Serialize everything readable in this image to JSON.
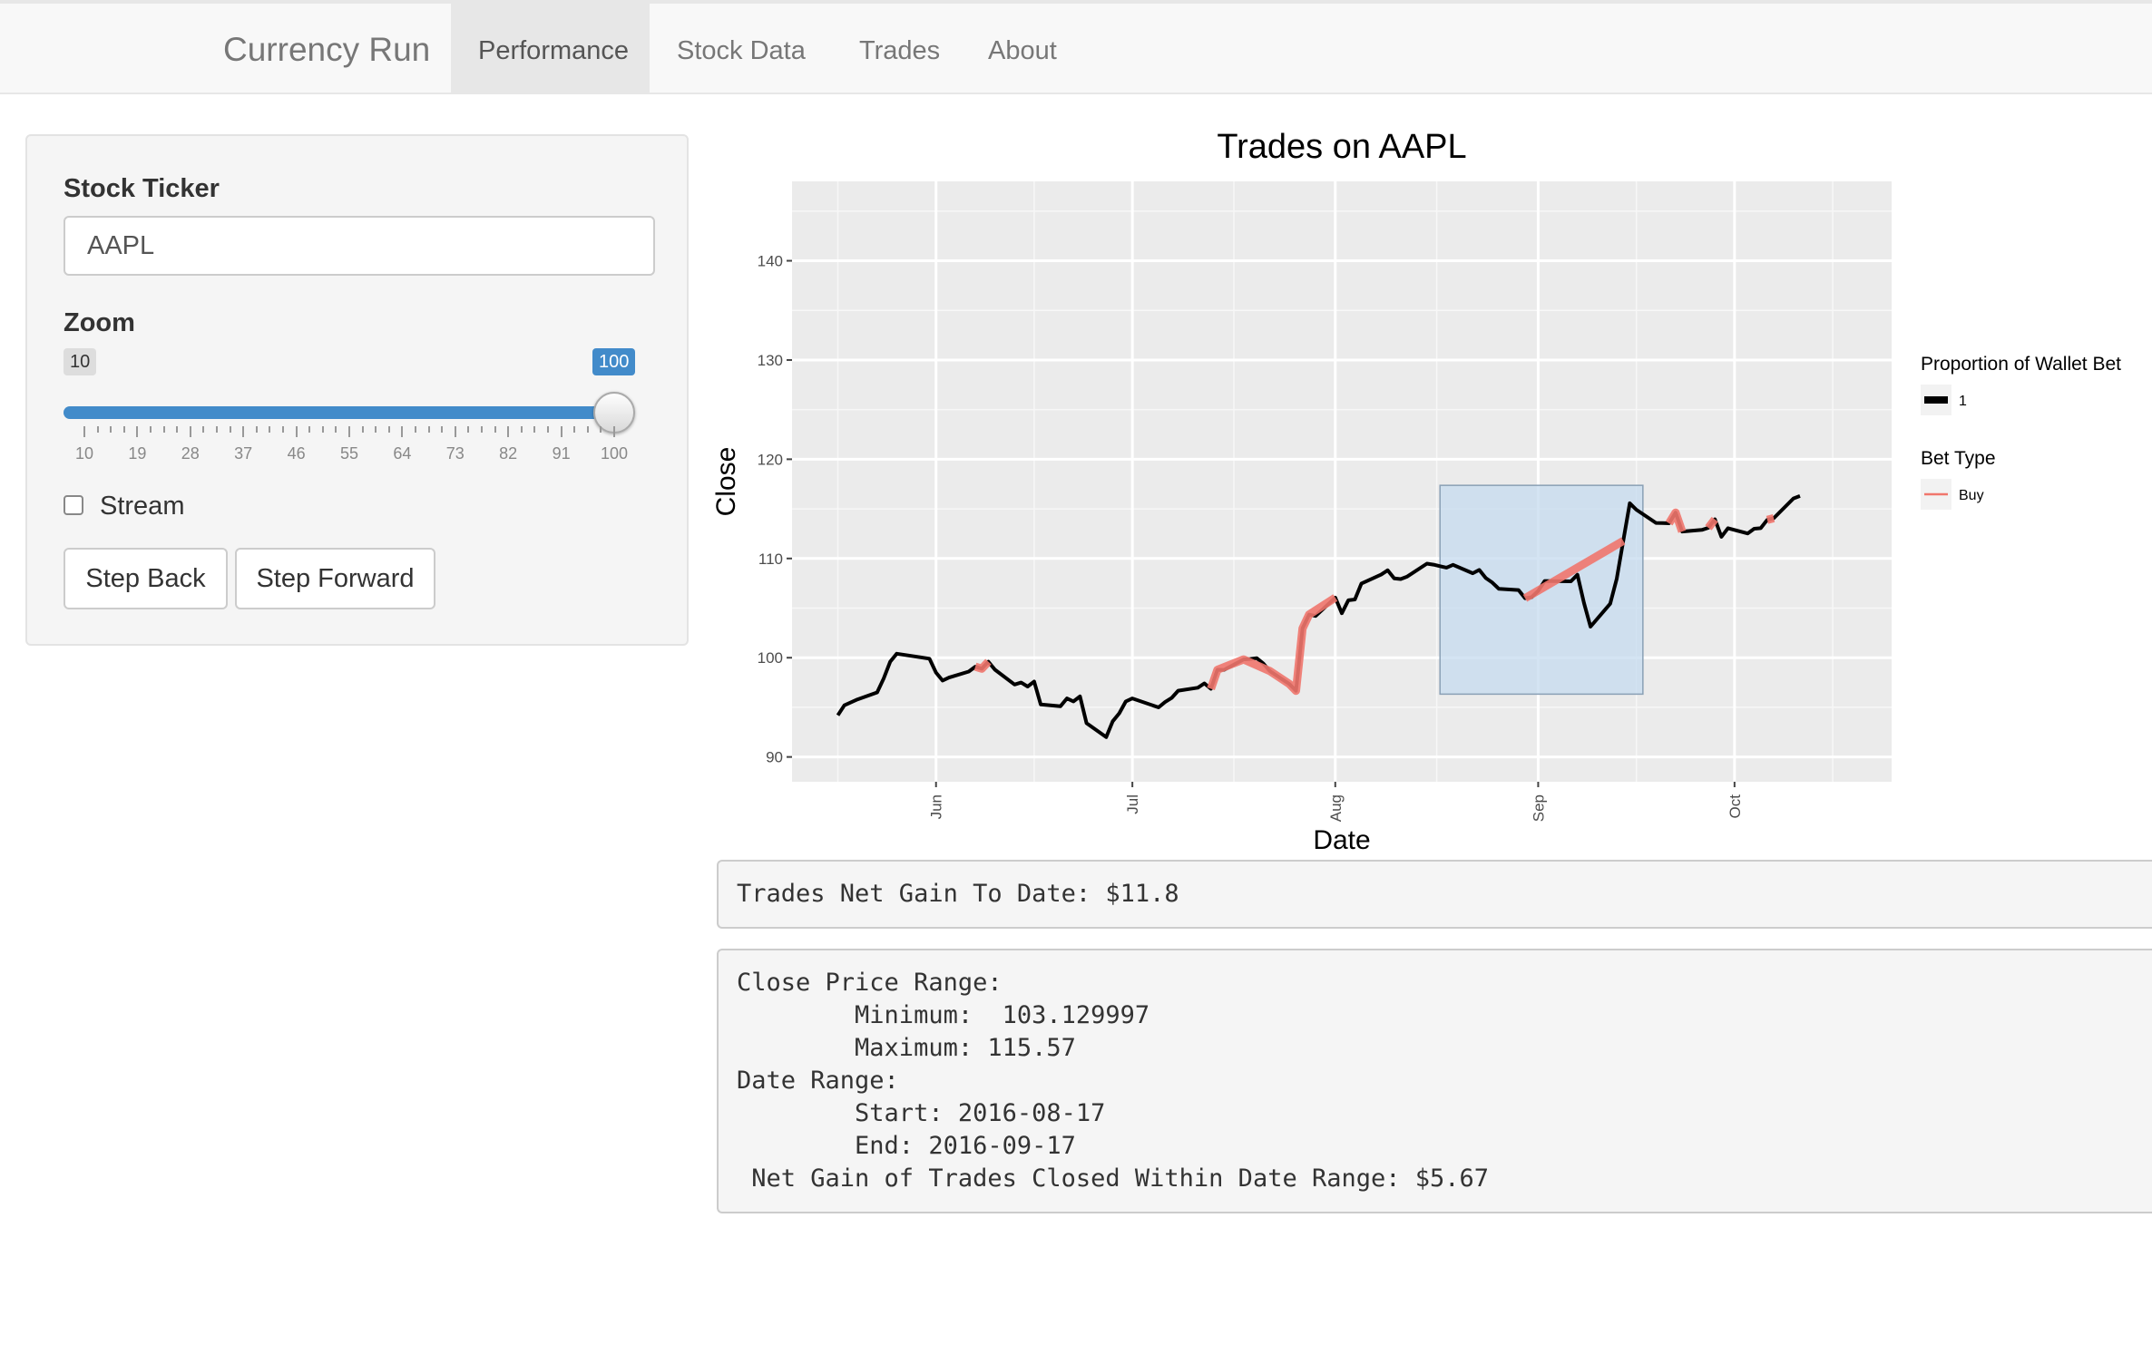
{
  "navbar": {
    "brand": "Currency Run",
    "tabs": [
      {
        "label": "Performance",
        "active": true
      },
      {
        "label": "Stock Data",
        "active": false
      },
      {
        "label": "Trades",
        "active": false
      },
      {
        "label": "About",
        "active": false
      }
    ]
  },
  "sidebar": {
    "ticker_label": "Stock Ticker",
    "ticker_value": "AAPL",
    "zoom_label": "Zoom",
    "zoom_min": "10",
    "zoom_max": "100",
    "zoom_value": "100",
    "zoom_ticks": [
      "10",
      "19",
      "28",
      "37",
      "46",
      "55",
      "64",
      "73",
      "82",
      "91",
      "100"
    ],
    "stream_label": "Stream",
    "stream_checked": false,
    "step_back_label": "Step Back",
    "step_forward_label": "Step Forward",
    "accent_color": "#428bca"
  },
  "chart_data": {
    "type": "line",
    "title": "Trades on AAPL",
    "xlabel": "Date",
    "ylabel": "Close",
    "x_ticks": [
      "Jun",
      "Jul",
      "Aug",
      "Sep",
      "Oct"
    ],
    "x_tick_dates": [
      "2016-06-01",
      "2016-07-01",
      "2016-08-01",
      "2016-09-01",
      "2016-10-01"
    ],
    "y_ticks": [
      90,
      100,
      110,
      120,
      130,
      140
    ],
    "xlim": [
      "2016-05-10",
      "2016-10-25"
    ],
    "ylim": [
      87.5,
      148
    ],
    "grid": true,
    "series": [
      {
        "color": "#000000",
        "points": [
          [
            "2016-05-17",
            94.2
          ],
          [
            "2016-05-18",
            95.2
          ],
          [
            "2016-05-20",
            95.8
          ],
          [
            "2016-05-23",
            96.5
          ],
          [
            "2016-05-24",
            97.9
          ],
          [
            "2016-05-25",
            99.6
          ],
          [
            "2016-05-26",
            100.4
          ],
          [
            "2016-05-31",
            99.9
          ],
          [
            "2016-06-01",
            98.5
          ],
          [
            "2016-06-02",
            97.7
          ],
          [
            "2016-06-03",
            98.0
          ],
          [
            "2016-06-06",
            98.6
          ],
          [
            "2016-06-07",
            99.1
          ],
          [
            "2016-06-08",
            98.9
          ],
          [
            "2016-06-09",
            99.6
          ],
          [
            "2016-06-10",
            98.8
          ],
          [
            "2016-06-13",
            97.3
          ],
          [
            "2016-06-14",
            97.5
          ],
          [
            "2016-06-15",
            97.1
          ],
          [
            "2016-06-16",
            97.6
          ],
          [
            "2016-06-17",
            95.3
          ],
          [
            "2016-06-20",
            95.1
          ],
          [
            "2016-06-21",
            95.9
          ],
          [
            "2016-06-22",
            95.6
          ],
          [
            "2016-06-23",
            96.1
          ],
          [
            "2016-06-24",
            93.4
          ],
          [
            "2016-06-27",
            92.0
          ],
          [
            "2016-06-28",
            93.6
          ],
          [
            "2016-06-29",
            94.4
          ],
          [
            "2016-06-30",
            95.6
          ],
          [
            "2016-07-01",
            95.9
          ],
          [
            "2016-07-05",
            94.99
          ],
          [
            "2016-07-06",
            95.53
          ],
          [
            "2016-07-07",
            95.94
          ],
          [
            "2016-07-08",
            96.68
          ],
          [
            "2016-07-11",
            96.98
          ],
          [
            "2016-07-12",
            97.42
          ],
          [
            "2016-07-13",
            96.87
          ],
          [
            "2016-07-14",
            98.79
          ],
          [
            "2016-07-15",
            98.78
          ],
          [
            "2016-07-18",
            99.83
          ],
          [
            "2016-07-19",
            99.87
          ],
          [
            "2016-07-20",
            99.96
          ],
          [
            "2016-07-21",
            99.43
          ],
          [
            "2016-07-22",
            98.66
          ],
          [
            "2016-07-25",
            97.34
          ],
          [
            "2016-07-26",
            96.67
          ],
          [
            "2016-07-27",
            102.95
          ],
          [
            "2016-07-28",
            104.34
          ],
          [
            "2016-07-29",
            104.21
          ],
          [
            "2016-08-01",
            106.05
          ],
          [
            "2016-08-02",
            104.48
          ],
          [
            "2016-08-03",
            105.79
          ],
          [
            "2016-08-04",
            105.87
          ],
          [
            "2016-08-05",
            107.48
          ],
          [
            "2016-08-08",
            108.37
          ],
          [
            "2016-08-09",
            108.81
          ],
          [
            "2016-08-10",
            108.0
          ],
          [
            "2016-08-11",
            107.93
          ],
          [
            "2016-08-12",
            108.18
          ],
          [
            "2016-08-15",
            109.48
          ],
          [
            "2016-08-16",
            109.38
          ],
          [
            "2016-08-17",
            109.22
          ],
          [
            "2016-08-18",
            109.08
          ],
          [
            "2016-08-19",
            109.36
          ],
          [
            "2016-08-22",
            108.51
          ],
          [
            "2016-08-23",
            108.85
          ],
          [
            "2016-08-24",
            108.03
          ],
          [
            "2016-08-25",
            107.57
          ],
          [
            "2016-08-26",
            106.94
          ],
          [
            "2016-08-29",
            106.82
          ],
          [
            "2016-08-30",
            106.0
          ],
          [
            "2016-08-31",
            106.1
          ],
          [
            "2016-09-01",
            106.73
          ],
          [
            "2016-09-02",
            107.73
          ],
          [
            "2016-09-06",
            107.7
          ],
          [
            "2016-09-07",
            108.36
          ],
          [
            "2016-09-08",
            105.52
          ],
          [
            "2016-09-09",
            103.13
          ],
          [
            "2016-09-12",
            105.44
          ],
          [
            "2016-09-13",
            107.95
          ],
          [
            "2016-09-14",
            111.77
          ],
          [
            "2016-09-15",
            115.57
          ],
          [
            "2016-09-16",
            114.92
          ],
          [
            "2016-09-19",
            113.58
          ],
          [
            "2016-09-20",
            113.57
          ],
          [
            "2016-09-21",
            113.55
          ],
          [
            "2016-09-22",
            114.62
          ],
          [
            "2016-09-23",
            112.71
          ],
          [
            "2016-09-26",
            112.88
          ],
          [
            "2016-09-27",
            113.09
          ],
          [
            "2016-09-28",
            113.95
          ],
          [
            "2016-09-29",
            112.18
          ],
          [
            "2016-09-30",
            113.05
          ],
          [
            "2016-10-03",
            112.52
          ],
          [
            "2016-10-04",
            113.0
          ],
          [
            "2016-10-05",
            113.05
          ],
          [
            "2016-10-06",
            113.89
          ],
          [
            "2016-10-07",
            114.06
          ],
          [
            "2016-10-10",
            116.05
          ],
          [
            "2016-10-11",
            116.3
          ]
        ]
      }
    ],
    "trades": [
      {
        "type": "Buy",
        "color": "#f0766d",
        "points": [
          [
            "2016-06-07",
            99.1
          ],
          [
            "2016-06-08",
            98.9
          ],
          [
            "2016-06-09",
            99.6
          ]
        ]
      },
      {
        "type": "Buy",
        "color": "#f0766d",
        "points": [
          [
            "2016-07-13",
            96.87
          ],
          [
            "2016-07-14",
            98.79
          ],
          [
            "2016-07-18",
            99.83
          ],
          [
            "2016-07-22",
            98.66
          ],
          [
            "2016-07-25",
            97.34
          ],
          [
            "2016-07-26",
            96.67
          ],
          [
            "2016-07-27",
            102.95
          ],
          [
            "2016-07-28",
            104.34
          ],
          [
            "2016-08-01",
            106.05
          ]
        ]
      },
      {
        "type": "Buy",
        "color": "#f0766d",
        "points": [
          [
            "2016-08-30",
            106.0
          ],
          [
            "2016-09-14",
            111.77
          ]
        ]
      },
      {
        "type": "Buy",
        "color": "#f0766d",
        "points": [
          [
            "2016-09-21",
            113.55
          ],
          [
            "2016-09-22",
            114.62
          ],
          [
            "2016-09-23",
            112.71
          ]
        ]
      },
      {
        "type": "Buy",
        "color": "#f0766d",
        "points": [
          [
            "2016-09-27",
            113.09
          ],
          [
            "2016-09-28",
            113.95
          ]
        ]
      },
      {
        "type": "Buy",
        "color": "#f0766d",
        "points": [
          [
            "2016-10-06",
            113.89
          ],
          [
            "2016-10-07",
            114.06
          ]
        ]
      }
    ],
    "highlight": {
      "x_start": "2016-08-17",
      "x_end": "2016-09-17",
      "y_min": 103.13,
      "y_max": 115.57,
      "color": "#c6dbef"
    },
    "legend": {
      "placement": "right",
      "size_title": "Proportion of Wallet Bet",
      "size_value": "1",
      "color_title": "Bet Type",
      "color_value": "Buy"
    }
  },
  "output": {
    "net_gain": "Trades Net Gain To Date: $11.8",
    "summary_lines": [
      "Close Price Range:",
      "        Minimum:  103.129997",
      "        Maximum: 115.57",
      "Date Range:",
      "        Start: 2016-08-17",
      "        End: 2016-09-17",
      " Net Gain of Trades Closed Within Date Range: $5.67"
    ]
  }
}
